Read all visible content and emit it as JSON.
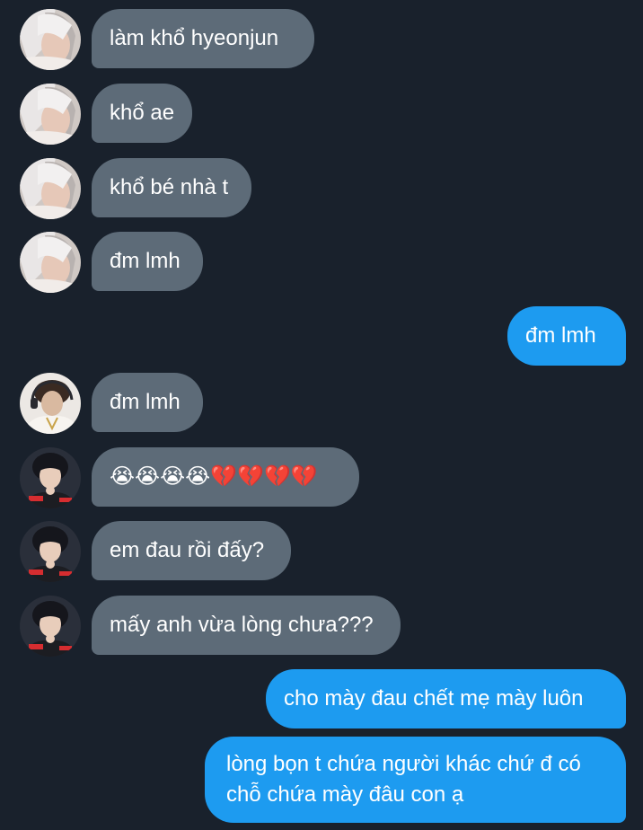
{
  "messages": [
    {
      "side": "in",
      "avatar": "avatar-silver-hair",
      "text": "làm khổ hyeonjun"
    },
    {
      "side": "in",
      "avatar": "avatar-silver-hair",
      "text": "khổ ae"
    },
    {
      "side": "in",
      "avatar": "avatar-silver-hair",
      "text": "khổ bé nhà t"
    },
    {
      "side": "in",
      "avatar": "avatar-silver-hair",
      "text": "đm lmh"
    },
    {
      "side": "out",
      "text": "đm lmh"
    },
    {
      "side": "in",
      "avatar": "avatar-headset",
      "text": "đm lmh"
    },
    {
      "side": "in",
      "avatar": "avatar-dark-hair",
      "text": "😭😭😭😭💔💔💔💔"
    },
    {
      "side": "in",
      "avatar": "avatar-dark-hair",
      "text": "em đau rồi đấy?"
    },
    {
      "side": "in",
      "avatar": "avatar-dark-hair",
      "text": "mấy anh vừa lòng chưa???"
    },
    {
      "side": "out",
      "text": "cho mày đau chết mẹ mày luôn"
    },
    {
      "side": "out",
      "text_line1": "lòng bọn t chứa người khác chứ đ có",
      "text_line2": "chỗ chứa mày đâu con ạ"
    }
  ],
  "colors": {
    "background": "#19212c",
    "incoming_bubble": "#5d6b78",
    "outgoing_bubble": "#1d9bf0",
    "text": "#ffffff"
  }
}
